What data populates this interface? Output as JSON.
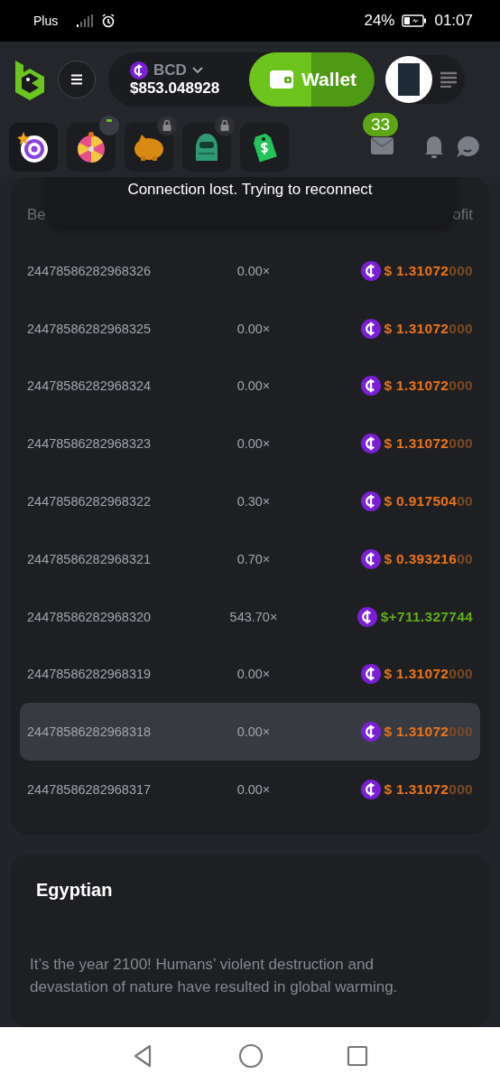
{
  "status_bar": {
    "carrier": "Plus",
    "battery": "24%",
    "time": "01:07"
  },
  "header": {
    "currency": "BCD",
    "balance": "$853.048928",
    "wallet_button": "Wallet"
  },
  "quick_bar": {
    "games": [
      {
        "kind": "target",
        "locked": false,
        "dot": false
      },
      {
        "kind": "wheel",
        "locked": false,
        "dot": true
      },
      {
        "kind": "piggy",
        "locked": true,
        "dot": false
      },
      {
        "kind": "robot",
        "locked": true,
        "dot": false
      },
      {
        "kind": "tag",
        "locked": false,
        "dot": false
      }
    ],
    "mail_badge": "33"
  },
  "toast": "Connection lost. Trying to reconnect",
  "table": {
    "column_1": "Be",
    "column_3": "ofit",
    "rows": [
      {
        "bet_id": "24478586282968326",
        "payout": "0.00×",
        "kind": "loss",
        "profit": "$ 1.31072",
        "profit_tail": "000",
        "selected": false
      },
      {
        "bet_id": "24478586282968325",
        "payout": "0.00×",
        "kind": "loss",
        "profit": "$ 1.31072",
        "profit_tail": "000",
        "selected": false
      },
      {
        "bet_id": "24478586282968324",
        "payout": "0.00×",
        "kind": "loss",
        "profit": "$ 1.31072",
        "profit_tail": "000",
        "selected": false
      },
      {
        "bet_id": "24478586282968323",
        "payout": "0.00×",
        "kind": "loss",
        "profit": "$ 1.31072",
        "profit_tail": "000",
        "selected": false
      },
      {
        "bet_id": "24478586282968322",
        "payout": "0.30×",
        "kind": "loss",
        "profit": "$ 0.917504",
        "profit_tail": "00",
        "selected": false
      },
      {
        "bet_id": "24478586282968321",
        "payout": "0.70×",
        "kind": "loss",
        "profit": "$ 0.393216",
        "profit_tail": "00",
        "selected": false
      },
      {
        "bet_id": "24478586282968320",
        "payout": "543.70×",
        "kind": "win",
        "profit": "$+711.327744",
        "selected": false
      },
      {
        "bet_id": "24478586282968319",
        "payout": "0.00×",
        "kind": "loss",
        "profit": "$ 1.31072",
        "profit_tail": "000",
        "selected": false
      },
      {
        "bet_id": "24478586282968318",
        "payout": "0.00×",
        "kind": "loss",
        "profit": "$ 1.31072",
        "profit_tail": "000",
        "selected": true
      },
      {
        "bet_id": "24478586282968317",
        "payout": "0.00×",
        "kind": "loss",
        "profit": "$ 1.31072",
        "profit_tail": "000",
        "selected": false
      }
    ]
  },
  "game_info": {
    "title": "Egyptian",
    "description": "It’s the year 2100! Humans’ violent destruction and devastation of nature have resulted in global warming."
  }
}
